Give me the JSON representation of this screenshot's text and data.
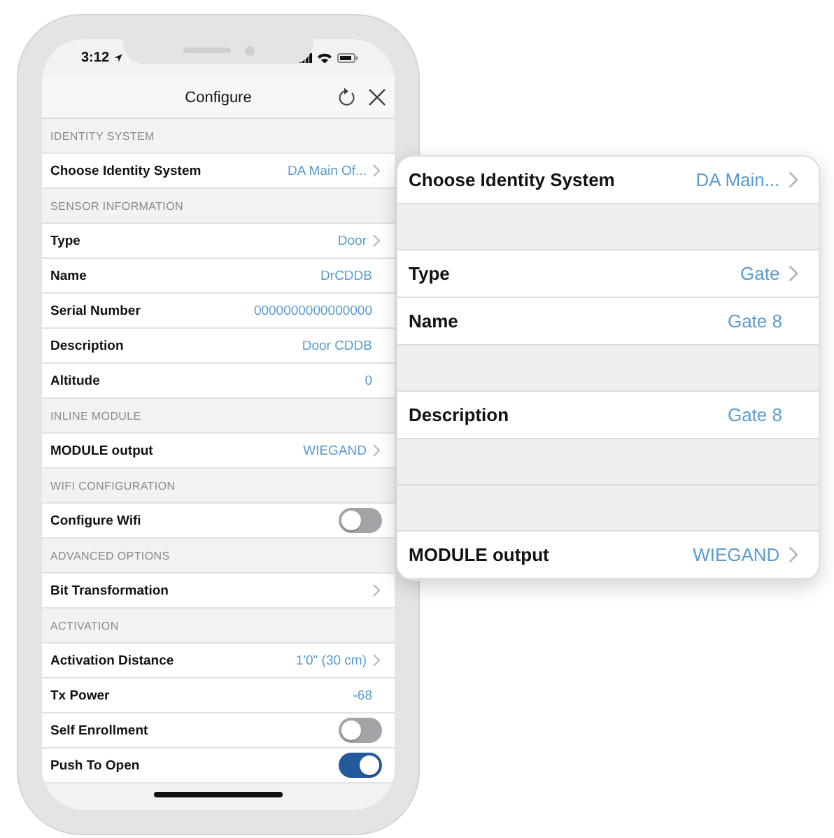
{
  "status_bar": {
    "time": "3:12"
  },
  "nav_bar": {
    "title": "Configure"
  },
  "sections": [
    {
      "header": "IDENTITY SYSTEM",
      "rows": [
        {
          "kind": "value",
          "label": "Choose Identity System",
          "value": "DA Main Of...",
          "chevron": true
        }
      ]
    },
    {
      "header": "SENSOR INFORMATION",
      "rows": [
        {
          "kind": "value",
          "label": "Type",
          "value": "Door",
          "chevron": true
        },
        {
          "kind": "value",
          "label": "Name",
          "value": "DrCDDB",
          "chevron": false
        },
        {
          "kind": "value",
          "label": "Serial Number",
          "value": "0000000000000000",
          "chevron": false
        },
        {
          "kind": "value",
          "label": "Description",
          "value": "Door CDDB",
          "chevron": false
        },
        {
          "kind": "value",
          "label": "Altitude",
          "value": "0",
          "chevron": false
        }
      ]
    },
    {
      "header": "INLINE MODULE",
      "rows": [
        {
          "kind": "value",
          "label": "MODULE output",
          "value": "WIEGAND",
          "chevron": true
        }
      ]
    },
    {
      "header": "WIFI CONFIGURATION",
      "rows": [
        {
          "kind": "toggle",
          "label": "Configure Wifi",
          "on": false
        }
      ]
    },
    {
      "header": "ADVANCED OPTIONS",
      "rows": [
        {
          "kind": "value",
          "label": "Bit Transformation",
          "chevron": true
        }
      ]
    },
    {
      "header": "ACTIVATION",
      "rows": [
        {
          "kind": "value",
          "label": "Activation Distance",
          "value": "1'0\" (30 cm)",
          "chevron": true
        },
        {
          "kind": "value",
          "label": "Tx Power",
          "value": "-68",
          "chevron": false
        },
        {
          "kind": "toggle",
          "label": "Self Enrollment",
          "on": false
        },
        {
          "kind": "toggle",
          "label": "Push To Open",
          "on": true
        }
      ]
    }
  ],
  "zoom_card": {
    "rows": [
      {
        "kind": "row",
        "label": "Choose Identity System",
        "value": "DA Main...",
        "chevron": true
      },
      {
        "kind": "blank"
      },
      {
        "kind": "row",
        "label": "Type",
        "value": "Gate",
        "chevron": true
      },
      {
        "kind": "row",
        "label": "Name",
        "value": "Gate 8",
        "chevron": false
      },
      {
        "kind": "blank"
      },
      {
        "kind": "row",
        "label": "Description",
        "value": "Gate  8",
        "chevron": false
      },
      {
        "kind": "blank"
      },
      {
        "kind": "blank"
      },
      {
        "kind": "row",
        "label": "MODULE output",
        "value": "WIEGAND",
        "chevron": true
      }
    ]
  }
}
